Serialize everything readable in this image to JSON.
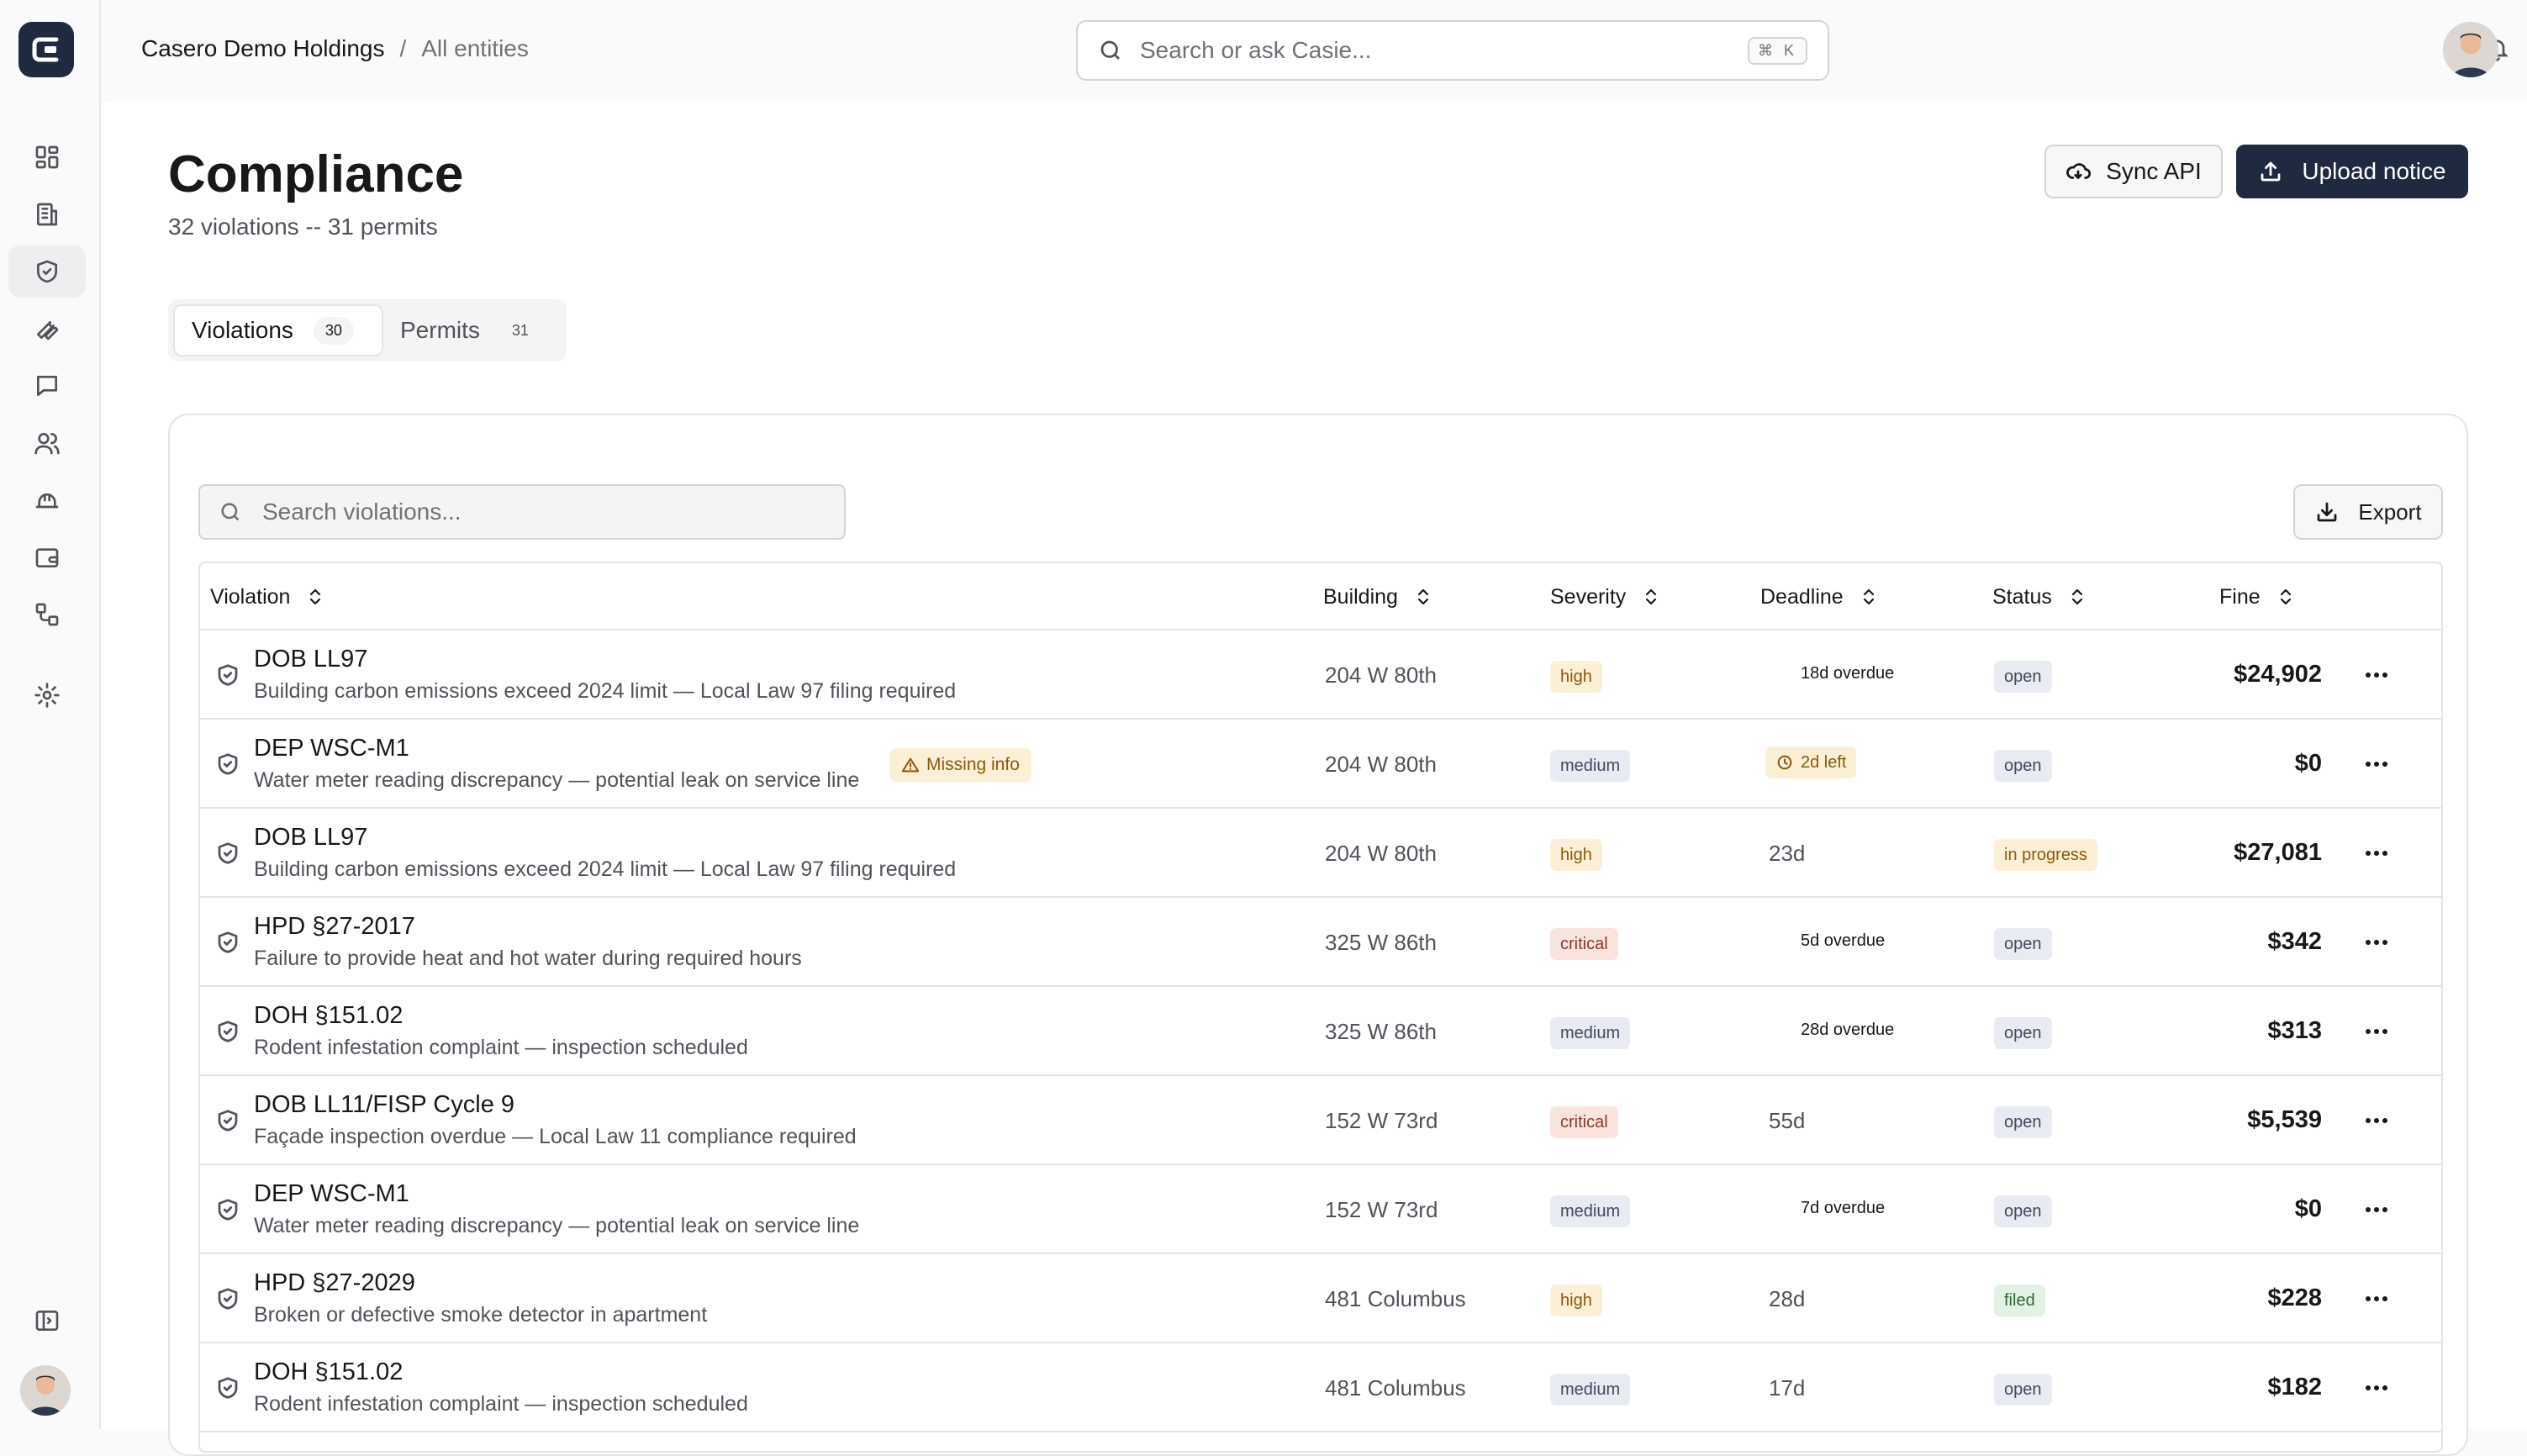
{
  "app": {
    "name": "Casero"
  },
  "breadcrumb": {
    "org": "Casero Demo Holdings",
    "separator": "/",
    "scope": "All entities"
  },
  "search": {
    "placeholder": "Search or ask Casie...",
    "shortcut": "⌘ K"
  },
  "nav": {
    "items": [
      "grid-icon",
      "building-icon",
      "shield-icon",
      "wrench-icon",
      "chat-icon",
      "users-icon",
      "helmet-icon",
      "wallet-icon",
      "workflow-icon",
      "gear-icon"
    ],
    "active": "shield-icon"
  },
  "page": {
    "title": "Compliance",
    "subtitle": "32 violations -- 31 permits"
  },
  "actions": {
    "sync": "Sync API",
    "upload": "Upload notice"
  },
  "tabs": [
    {
      "label": "Violations",
      "count": "30",
      "active": true
    },
    {
      "label": "Permits",
      "count": "31",
      "active": false
    }
  ],
  "toolbar": {
    "search_placeholder": "Search violations...",
    "export": "Export"
  },
  "table": {
    "headers": {
      "violation": "Violation",
      "building": "Building",
      "severity": "Severity",
      "deadline": "Deadline",
      "status": "Status",
      "fine": "Fine"
    },
    "rows": [
      {
        "code": "DOB LL97",
        "desc": "Building carbon emissions exceed 2024 limit — Local Law 97 filing required",
        "flag": "",
        "building": "204 W 80th",
        "severity": "high",
        "deadline": "18d overdue",
        "deadline_kind": "overdue",
        "status": "open",
        "fine": "$24,902"
      },
      {
        "code": "DEP WSC-M1",
        "desc": "Water meter reading discrepancy — potential leak on service line",
        "flag": "Missing info",
        "building": "204 W 80th",
        "severity": "medium",
        "deadline": "2d left",
        "deadline_kind": "soon",
        "status": "open",
        "fine": "$0"
      },
      {
        "code": "DOB LL97",
        "desc": "Building carbon emissions exceed 2024 limit — Local Law 97 filing required",
        "flag": "",
        "building": "204 W 80th",
        "severity": "high",
        "deadline": "23d",
        "deadline_kind": "plain",
        "status": "in progress",
        "fine": "$27,081"
      },
      {
        "code": "HPD §27-2017",
        "desc": "Failure to provide heat and hot water during required hours",
        "flag": "",
        "building": "325 W 86th",
        "severity": "critical",
        "deadline": "5d overdue",
        "deadline_kind": "overdue",
        "status": "open",
        "fine": "$342"
      },
      {
        "code": "DOH §151.02",
        "desc": "Rodent infestation complaint — inspection scheduled",
        "flag": "",
        "building": "325 W 86th",
        "severity": "medium",
        "deadline": "28d overdue",
        "deadline_kind": "overdue",
        "status": "open",
        "fine": "$313"
      },
      {
        "code": "DOB LL11/FISP Cycle 9",
        "desc": "Façade inspection overdue — Local Law 11 compliance required",
        "flag": "",
        "building": "152 W 73rd",
        "severity": "critical",
        "deadline": "55d",
        "deadline_kind": "plain",
        "status": "open",
        "fine": "$5,539"
      },
      {
        "code": "DEP WSC-M1",
        "desc": "Water meter reading discrepancy — potential leak on service line",
        "flag": "",
        "building": "152 W 73rd",
        "severity": "medium",
        "deadline": "7d overdue",
        "deadline_kind": "overdue",
        "status": "open",
        "fine": "$0"
      },
      {
        "code": "HPD §27-2029",
        "desc": "Broken or defective smoke detector in apartment",
        "flag": "",
        "building": "481 Columbus",
        "severity": "high",
        "deadline": "28d",
        "deadline_kind": "plain",
        "status": "filed",
        "fine": "$228"
      },
      {
        "code": "DOH §151.02",
        "desc": "Rodent infestation complaint — inspection scheduled",
        "flag": "",
        "building": "481 Columbus",
        "severity": "medium",
        "deadline": "17d",
        "deadline_kind": "plain",
        "status": "open",
        "fine": "$182"
      }
    ]
  },
  "colors": {
    "brand": "#1f2940",
    "severity": {
      "high": "#fbf0d5",
      "medium": "#e8ebf1",
      "critical": "#fbe3de"
    },
    "severity_text": {
      "high": "#8a5a0c",
      "medium": "#3f4a5e",
      "critical": "#8d3a2a"
    },
    "status": {
      "open": "#e8ebf1",
      "in progress": "#fbf0d5",
      "filed": "#e2f2e4"
    },
    "status_text": {
      "open": "#3f4a5e",
      "in progress": "#8a5a0c",
      "filed": "#2d6a36"
    }
  }
}
